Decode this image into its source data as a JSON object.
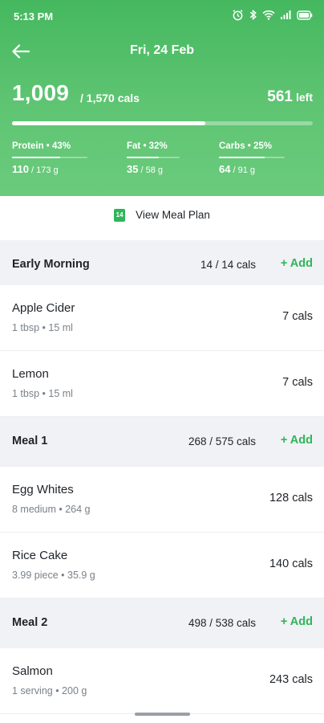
{
  "status_bar": {
    "time": "5:13 PM"
  },
  "header": {
    "date": "Fri, 24 Feb",
    "calories_eaten": "1,009",
    "calories_total": "/ 1,570 cals",
    "calories_left_value": "561",
    "calories_left_label": "left",
    "calories_progress": 0.643,
    "macros": [
      {
        "label": "Protein  •  43%",
        "value": "110",
        "total": " / 173 g",
        "progress": 0.64
      },
      {
        "label": "Fat  •  32%",
        "value": "35",
        "total": " / 58 g",
        "progress": 0.6
      },
      {
        "label": "Carbs  •  25%",
        "value": "64",
        "total": " / 91 g",
        "progress": 0.7
      }
    ]
  },
  "meal_plan": {
    "icon_text": "14",
    "label": "View Meal Plan"
  },
  "sections": [
    {
      "name": "Early Morning",
      "cals": "14 / 14 cals",
      "add_label": "+ Add"
    },
    {
      "name": "Meal 1",
      "cals": "268 / 575 cals",
      "add_label": "+ Add"
    },
    {
      "name": "Meal 2",
      "cals": "498 / 538 cals",
      "add_label": "+ Add"
    }
  ],
  "items": [
    {
      "name": "Apple Cider",
      "qty": "1 tbsp  •  15 ml",
      "cals": "7 cals"
    },
    {
      "name": "Lemon",
      "qty": "1 tbsp  •  15 ml",
      "cals": "7 cals"
    },
    {
      "name": "Egg Whites",
      "qty": "8 medium  •  264 g",
      "cals": "128 cals"
    },
    {
      "name": "Rice Cake",
      "qty": "3.99 piece  •  35.9 g",
      "cals": "140 cals"
    },
    {
      "name": "Salmon",
      "qty": "1 serving  •  200 g",
      "cals": "243 cals"
    }
  ],
  "colors": {
    "header_green": "#5fc573",
    "accent_green": "#2fb55a",
    "section_bg": "#f0f2f5"
  }
}
